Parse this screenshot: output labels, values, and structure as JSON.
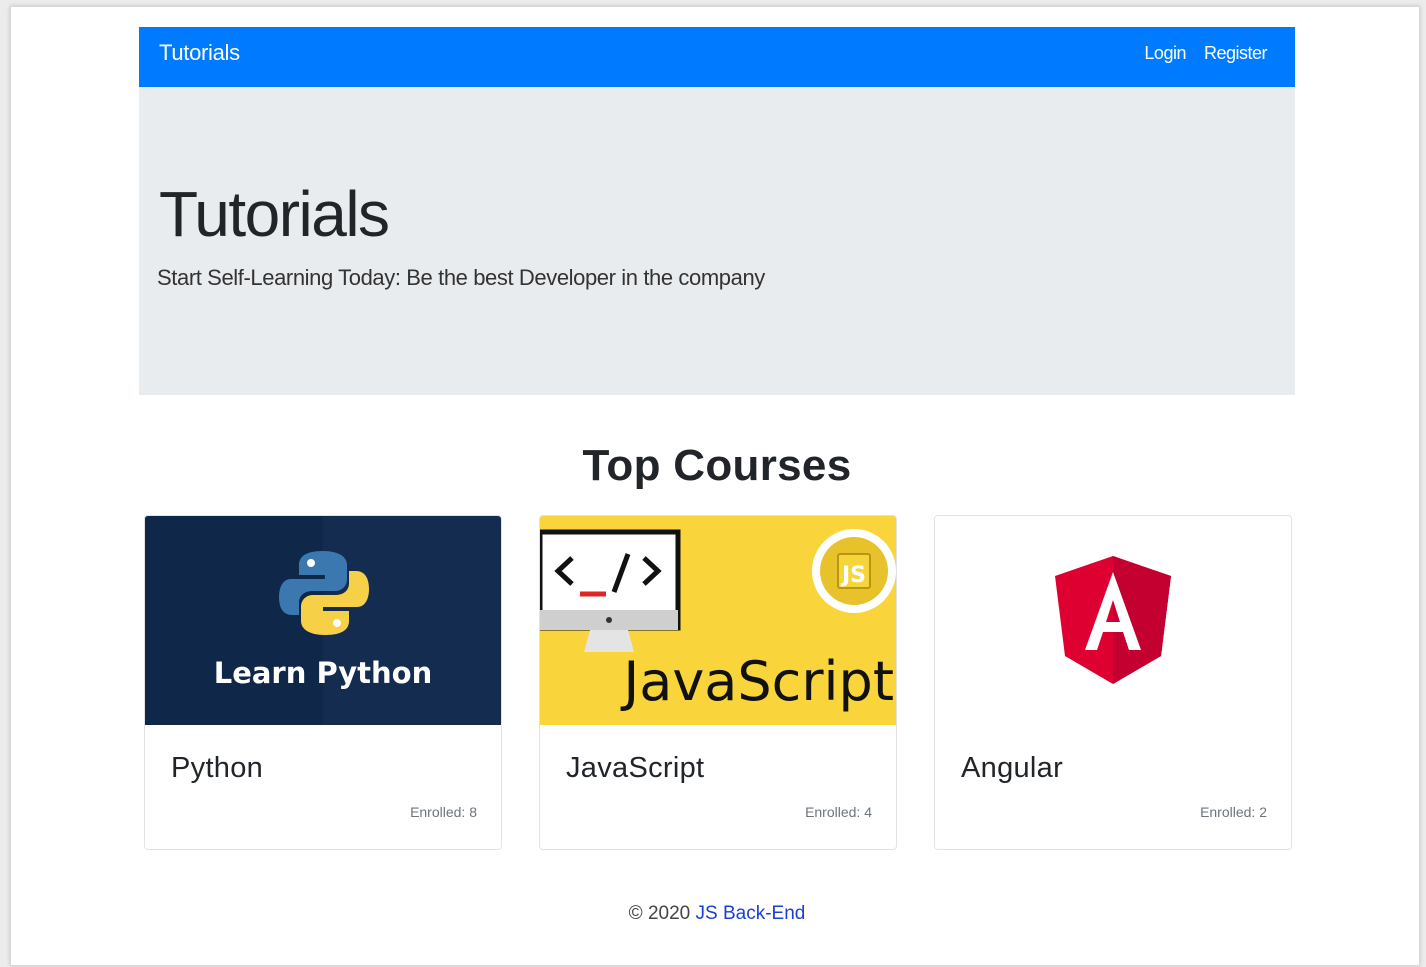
{
  "navbar": {
    "brand": "Tutorials",
    "links": [
      "Login",
      "Register"
    ],
    "bg_color": "#007bff"
  },
  "jumbotron": {
    "title": "Tutorials",
    "lead": "Start Self-Learning Today: Be the best Developer in the company"
  },
  "section": {
    "title": "Top Courses"
  },
  "courses": [
    {
      "title": "Python",
      "enrolled": "Enrolled: 8",
      "banner_text": "Learn Python",
      "image_icon": "python-logo-icon"
    },
    {
      "title": "JavaScript",
      "enrolled": "Enrolled: 4",
      "banner_text": "JavaScript",
      "image_icon": "monitor-code-icon",
      "badge_text": "JS"
    },
    {
      "title": "Angular",
      "enrolled": "Enrolled: 2",
      "image_icon": "angular-logo-icon"
    }
  ],
  "footer": {
    "copyright": "© 2020 ",
    "link": "JS Back-End"
  }
}
